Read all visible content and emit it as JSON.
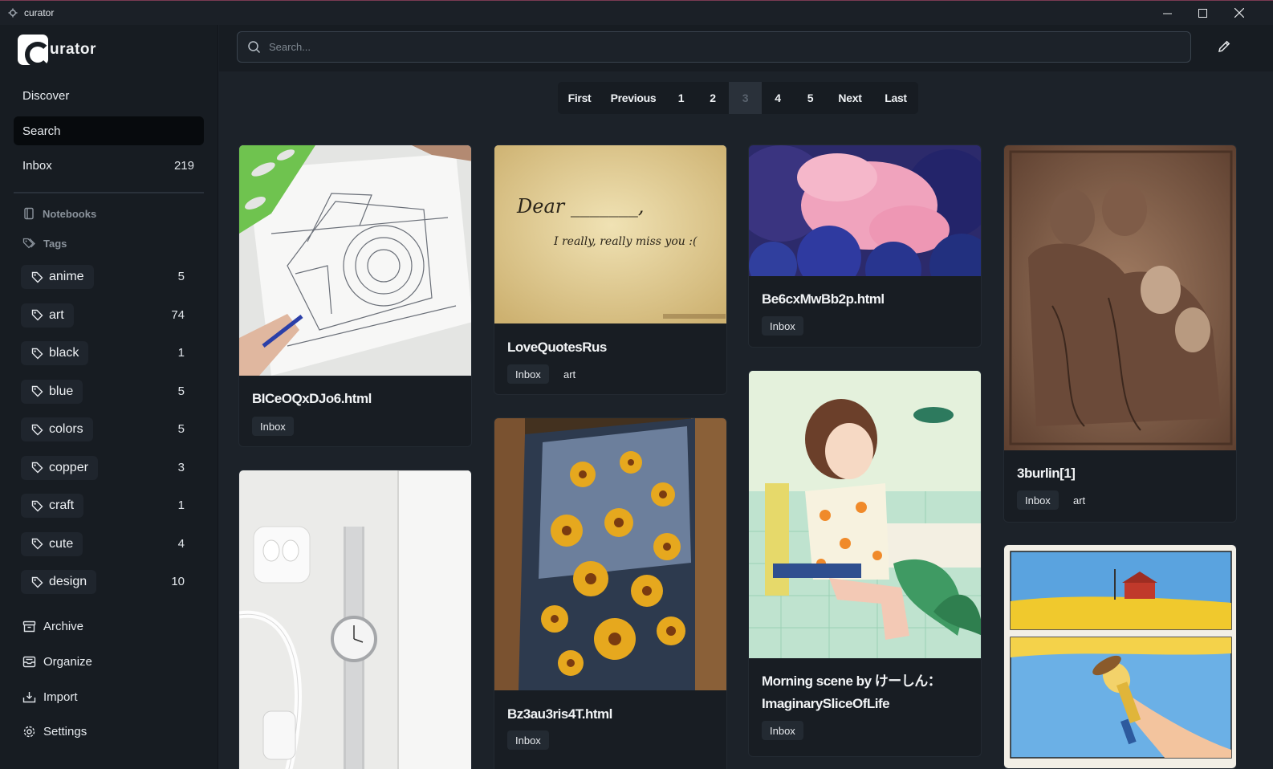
{
  "window": {
    "title": "curator"
  },
  "logo": {
    "text": "urator"
  },
  "nav": {
    "discover": "Discover",
    "search": "Search",
    "inbox": "Inbox",
    "inbox_count": "219"
  },
  "sections": {
    "notebooks": "Notebooks",
    "tags": "Tags"
  },
  "tags": [
    {
      "label": "anime",
      "count": "5"
    },
    {
      "label": "art",
      "count": "74"
    },
    {
      "label": "black",
      "count": "1"
    },
    {
      "label": "blue",
      "count": "5"
    },
    {
      "label": "colors",
      "count": "5"
    },
    {
      "label": "copper",
      "count": "3"
    },
    {
      "label": "craft",
      "count": "1"
    },
    {
      "label": "cute",
      "count": "4"
    },
    {
      "label": "design",
      "count": "10"
    }
  ],
  "bottom_nav": {
    "archive": "Archive",
    "organize": "Organize",
    "import": "Import",
    "settings": "Settings"
  },
  "search": {
    "placeholder": "Search..."
  },
  "pagination": {
    "first": "First",
    "previous": "Previous",
    "pages": [
      "1",
      "2",
      "3",
      "4",
      "5"
    ],
    "current": "3",
    "next": "Next",
    "last": "Last"
  },
  "cards": [
    {
      "title": "BICeOQxDJo6.html",
      "tags": [
        "Inbox"
      ],
      "image": "camera-sketch"
    },
    {
      "title": "",
      "tags": [],
      "image": "watch-earphones"
    },
    {
      "title": "LoveQuotesRus",
      "tags": [
        "Inbox",
        "art"
      ],
      "image": "love-letter",
      "image_text": [
        "Dear _______,",
        "I really, really miss you :("
      ]
    },
    {
      "title": "Bz3au3ris4T.html",
      "tags": [
        "Inbox"
      ],
      "image": "flower-painting"
    },
    {
      "title": "Be6cxMwBb2p.html",
      "tags": [
        "Inbox"
      ],
      "image": "pink-clouds"
    },
    {
      "title": "Morning scene by けーしん：ImaginarySliceOfLife",
      "title_line1": "Morning scene by けーしん：",
      "title_line2": "ImaginarySliceOfLife",
      "tags": [
        "Inbox"
      ],
      "image": "anime-girl"
    },
    {
      "title": "3burlin[1]",
      "tags": [
        "Inbox",
        "art"
      ],
      "image": "renaissance-drawing"
    },
    {
      "title": "",
      "tags": [],
      "image": "comic-panels"
    }
  ],
  "colors": {
    "bg": "#1c2229",
    "sidebar": "#171c22",
    "card": "#181d23",
    "active": "#070a0d"
  }
}
